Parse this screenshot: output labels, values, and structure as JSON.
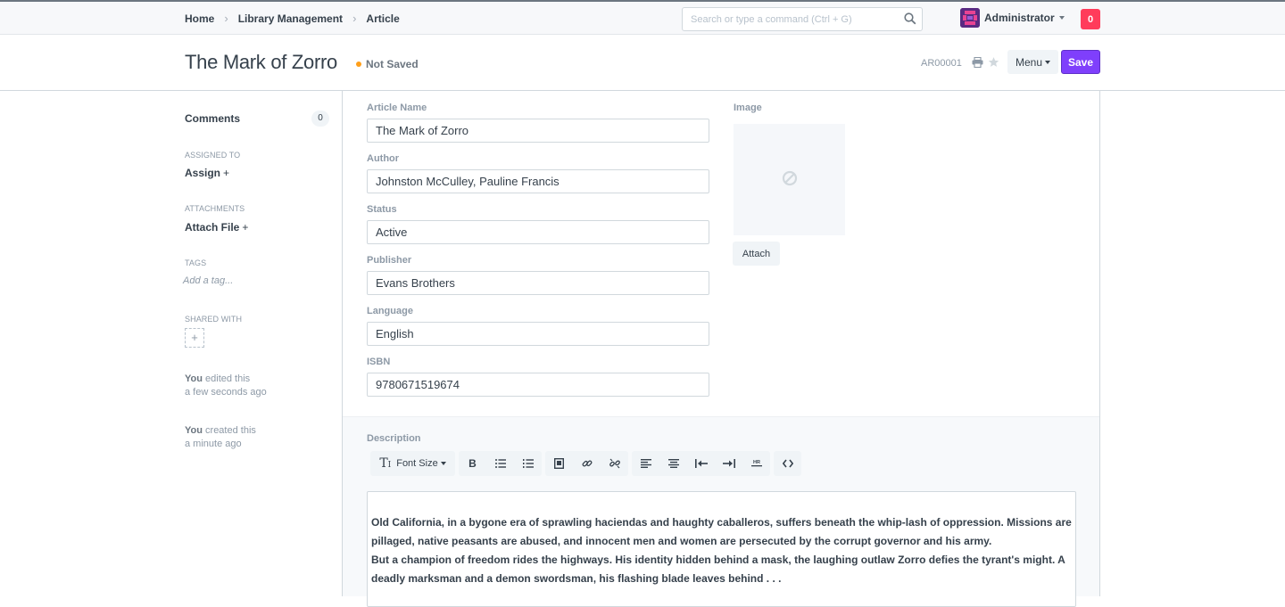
{
  "navbar": {
    "breadcrumbs": [
      "Home",
      "Library Management",
      "Article"
    ],
    "search_placeholder": "Search or type a command (Ctrl + G)",
    "user_name": "Administrator",
    "notification_count": "0"
  },
  "page": {
    "title": "The Mark of Zorro",
    "status": "Not Saved",
    "docname": "AR00001",
    "menu_label": "Menu",
    "save_label": "Save"
  },
  "sidebar": {
    "comments_label": "Comments",
    "comments_count": "0",
    "assigned_label": "ASSIGNED TO",
    "assign_action": "Assign",
    "attachments_label": "ATTACHMENTS",
    "attach_action": "Attach File",
    "tags_label": "TAGS",
    "add_tag": "Add a tag...",
    "shared_label": "SHARED WITH",
    "activity": [
      {
        "who": "You",
        "what": "edited this",
        "when": "a few seconds ago"
      },
      {
        "who": "You",
        "what": "created this",
        "when": "a minute ago"
      }
    ]
  },
  "form": {
    "fields": [
      {
        "label": "Article Name",
        "value": "The Mark of Zorro"
      },
      {
        "label": "Author",
        "value": "Johnston McCulley, Pauline Francis"
      },
      {
        "label": "Status",
        "value": "Active"
      },
      {
        "label": "Publisher",
        "value": "Evans Brothers"
      },
      {
        "label": "Language",
        "value": "English"
      },
      {
        "label": "ISBN",
        "value": "9780671519674"
      }
    ],
    "image_label": "Image",
    "attach_label": "Attach",
    "description_label": "Description",
    "font_size_label": "Font Size",
    "description_paragraphs": [
      "Old California, in a bygone era of sprawling haciendas and haughty caballeros, suffers beneath the whip-lash of oppression. Missions are pillaged, native peasants are abused, and innocent men and women are persecuted by the corrupt governor and his army.",
      "But a champion of freedom rides the highways. His identity hidden behind a mask, the laughing outlaw Zorro defies the tyrant's might. A deadly marksman and a demon swordsman, his flashing blade leaves behind . . ."
    ]
  },
  "colors": {
    "primary": "#7f3ffc",
    "notification": "#ff3c5b",
    "not_saved_indicator": "#ff9f1a"
  }
}
